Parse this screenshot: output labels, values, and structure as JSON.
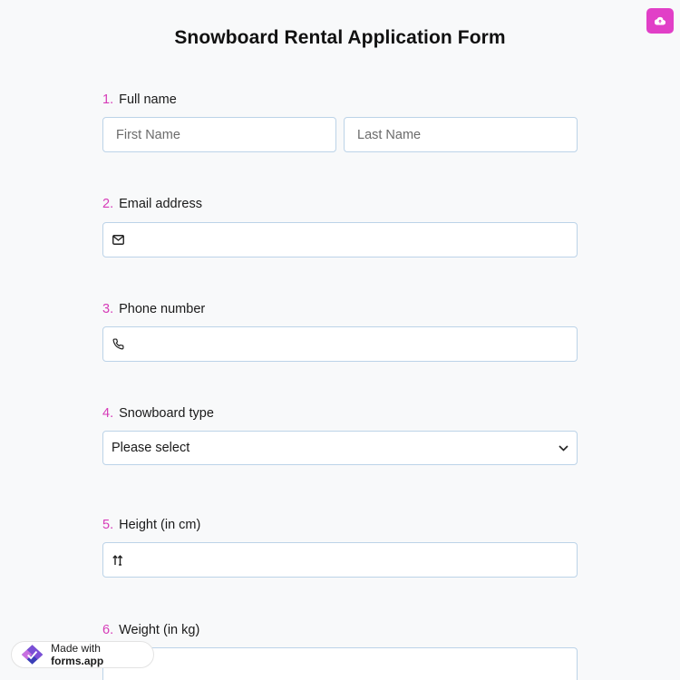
{
  "form": {
    "title": "Snowboard Rental Application Form"
  },
  "toolbar": {
    "save_icon": "cloud-upload-icon",
    "accent_color": "#e13fc7"
  },
  "questions": [
    {
      "number": "1.",
      "label": "Full name",
      "fields": [
        {
          "placeholder": "First Name",
          "value": ""
        },
        {
          "placeholder": "Last Name",
          "value": ""
        }
      ]
    },
    {
      "number": "2.",
      "label": "Email address",
      "icon": "envelope-icon",
      "value": ""
    },
    {
      "number": "3.",
      "label": "Phone number",
      "icon": "phone-icon",
      "value": ""
    },
    {
      "number": "4.",
      "label": "Snowboard type",
      "selected": "Please select",
      "icon": "chevron-down-icon"
    },
    {
      "number": "5.",
      "label": "Height (in cm)",
      "icon": "height-arrows-icon",
      "value": ""
    },
    {
      "number": "6.",
      "label": "Weight (in kg)",
      "value": ""
    }
  ],
  "badge": {
    "prefix": "Made with ",
    "brand": "forms.app",
    "icon": "forms-app-logo-icon"
  }
}
